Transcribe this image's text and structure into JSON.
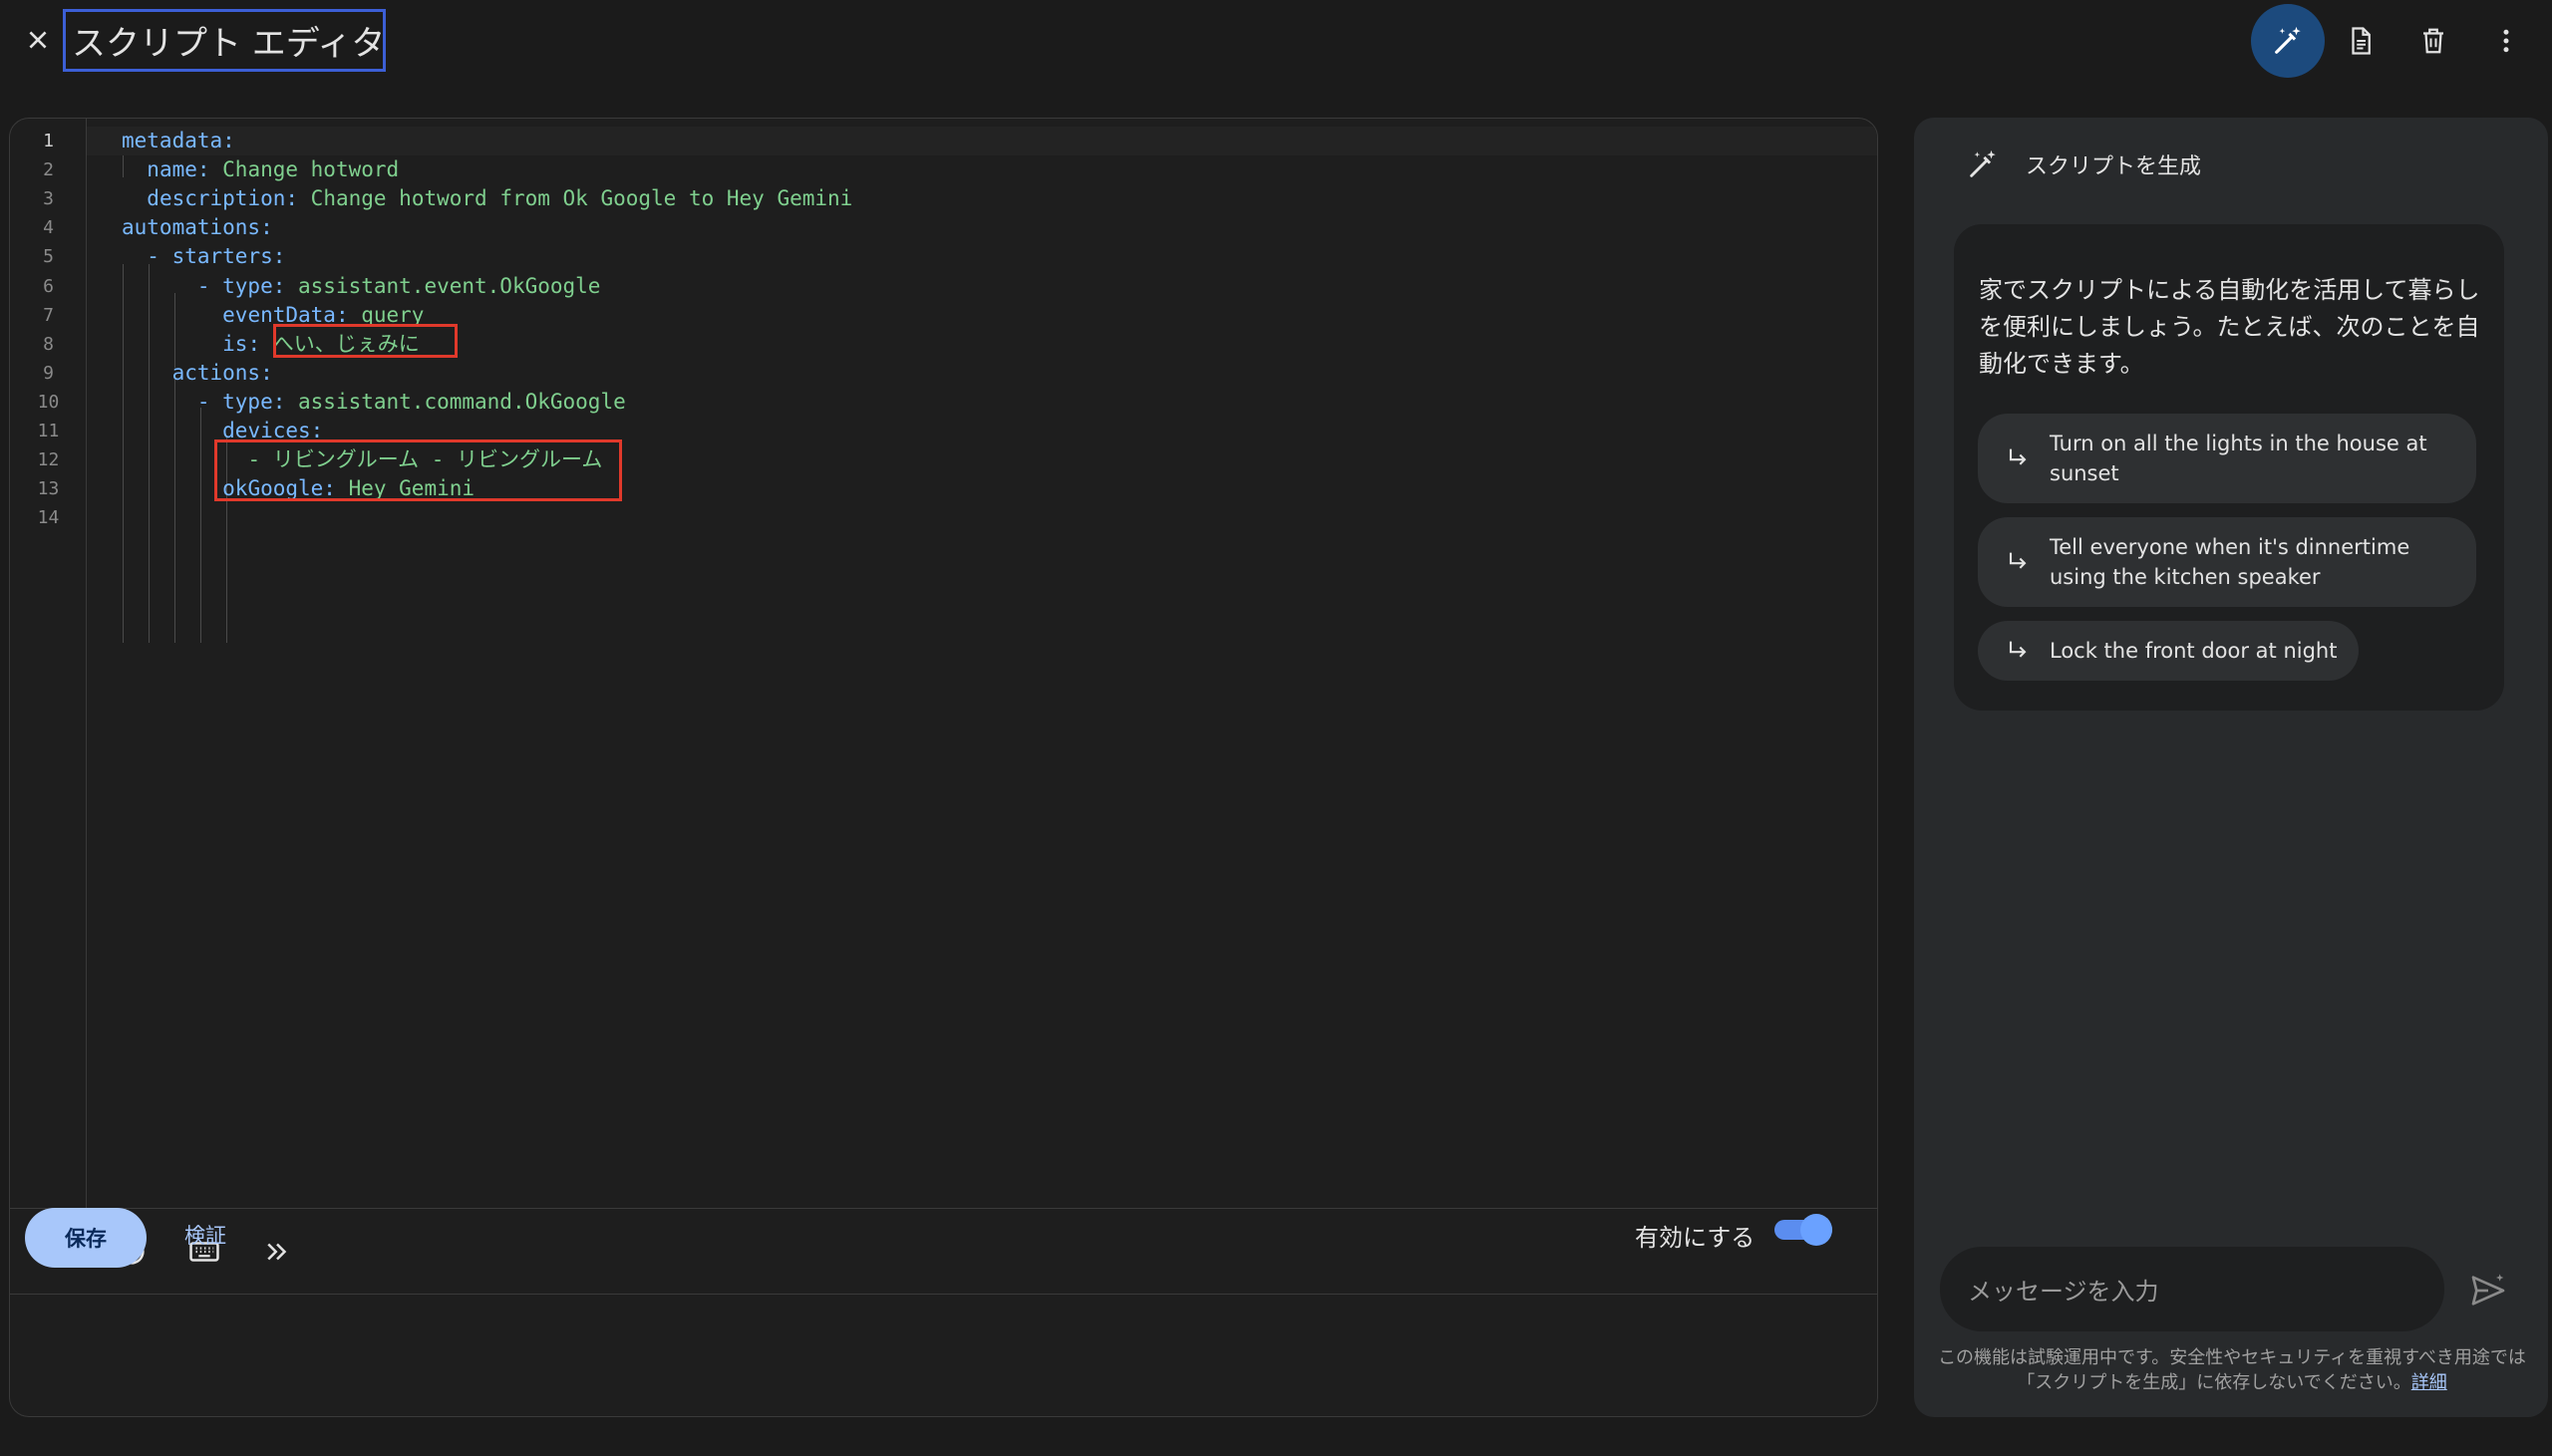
{
  "header": {
    "title": "スクリプト エディタ",
    "icons": [
      "close-icon",
      "magic-pen-icon",
      "document-icon",
      "delete-icon",
      "more-vert-icon"
    ]
  },
  "editor": {
    "lines": [
      {
        "num": "1",
        "indent": "",
        "key": "metadata:",
        "value": ""
      },
      {
        "num": "2",
        "indent": "  ",
        "key": "name: ",
        "value": "Change hotword"
      },
      {
        "num": "3",
        "indent": "  ",
        "key": "description: ",
        "value": "Change hotword from Ok Google to Hey Gemini"
      },
      {
        "num": "4",
        "indent": "",
        "key": "automations:",
        "value": ""
      },
      {
        "num": "5",
        "indent": "  ",
        "key": "- starters:",
        "value": ""
      },
      {
        "num": "6",
        "indent": "      ",
        "key": "- type: ",
        "value": "assistant.event.OkGoogle"
      },
      {
        "num": "7",
        "indent": "        ",
        "key": "eventData: ",
        "value": "query"
      },
      {
        "num": "8",
        "indent": "        ",
        "key": "is: ",
        "value": "へい、じぇみに"
      },
      {
        "num": "9",
        "indent": "    ",
        "key": "actions:",
        "value": ""
      },
      {
        "num": "10",
        "indent": "      ",
        "key": "- type: ",
        "value": "assistant.command.OkGoogle"
      },
      {
        "num": "11",
        "indent": "        ",
        "key": "devices:",
        "value": ""
      },
      {
        "num": "12",
        "indent": "          ",
        "key": "",
        "value": "- リビングルーム - リビングルーム"
      },
      {
        "num": "13",
        "indent": "        ",
        "key": "okGoogle: ",
        "value": "Hey Gemini"
      },
      {
        "num": "14",
        "indent": "",
        "key": "",
        "value": ""
      }
    ],
    "toolbar_icons": [
      "error-icon",
      "history-icon",
      "keyboard-icon",
      "expand-icon"
    ]
  },
  "footer": {
    "save_label": "保存",
    "verify_label": "検証",
    "enable_label": "有効にする",
    "enabled": true
  },
  "side": {
    "header_label": "スクリプトを生成",
    "intro": "家でスクリプトによる自動化を活用して暮らしを便利にしましょう。たとえば、次のことを自動化できます。",
    "suggestions": [
      "Turn on all the lights in the house at sunset",
      "Tell everyone when it's dinnertime using the kitchen speaker",
      "Lock the front door at night"
    ],
    "input_placeholder": "メッセージを入力",
    "disclaimer": "この機能は試験運用中です。安全性やセキュリティを重視すべき用途では「スクリプトを生成」に依存しないでください。",
    "disclaimer_link": "詳細"
  },
  "colors": {
    "accent": "#a8c7fa",
    "highlight_box": "#e0392b",
    "title_box": "#3c5fd6",
    "yaml_key": "#79b8ff",
    "yaml_value": "#7fcf8e"
  }
}
